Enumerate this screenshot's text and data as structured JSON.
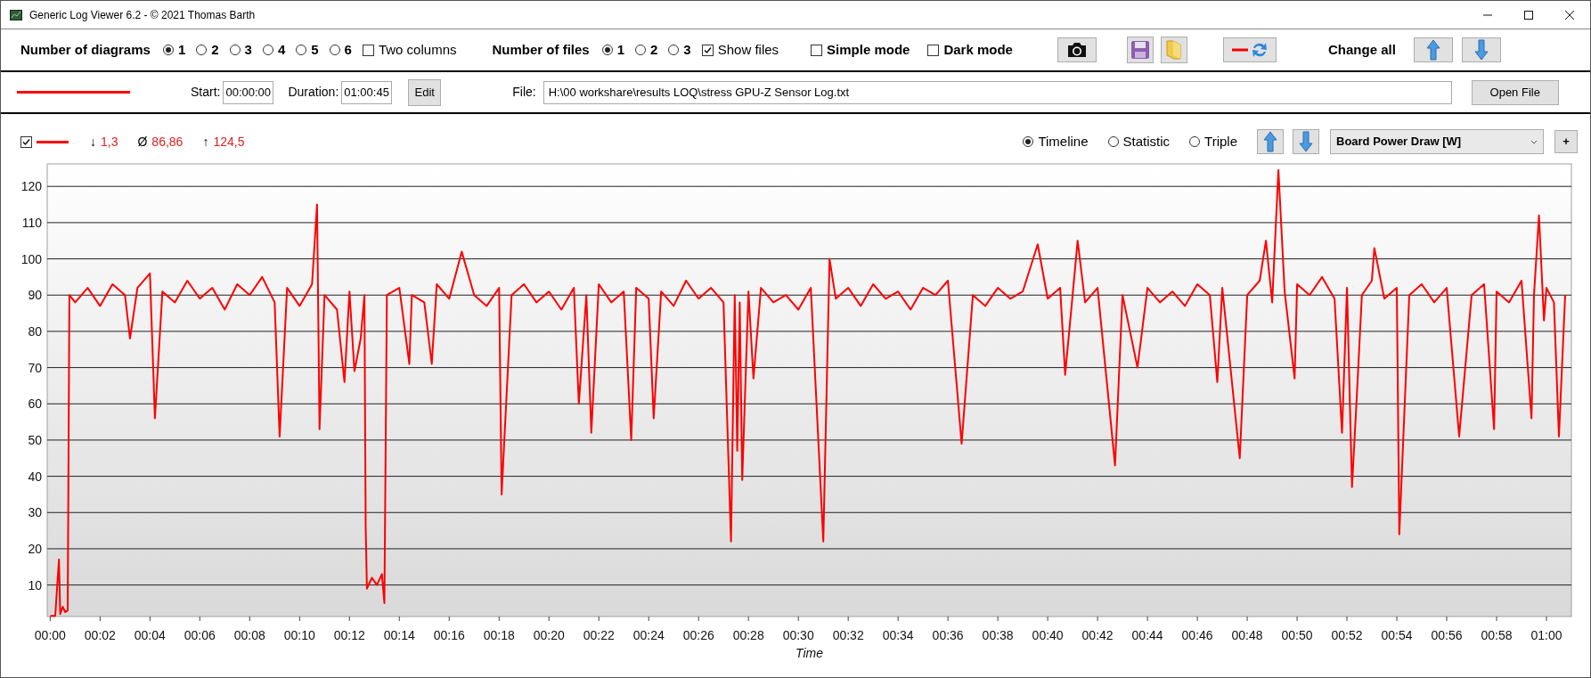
{
  "window": {
    "title": "Generic Log Viewer 6.2 - © 2021 Thomas Barth"
  },
  "toolbar": {
    "diagrams": {
      "label": "Number of diagrams",
      "options": [
        {
          "label": "1",
          "selected": true
        },
        {
          "label": "2",
          "selected": false
        },
        {
          "label": "3",
          "selected": false
        },
        {
          "label": "4",
          "selected": false
        },
        {
          "label": "5",
          "selected": false
        },
        {
          "label": "6",
          "selected": false
        }
      ]
    },
    "two_columns": {
      "label": "Two columns",
      "checked": false
    },
    "files": {
      "label": "Number of files",
      "options": [
        {
          "label": "1",
          "selected": true
        },
        {
          "label": "2",
          "selected": false
        },
        {
          "label": "3",
          "selected": false
        }
      ]
    },
    "show_files": {
      "label": "Show files",
      "checked": true
    },
    "simple_mode": {
      "label": "Simple mode",
      "checked": false
    },
    "dark_mode": {
      "label": "Dark mode",
      "checked": false
    },
    "change_all": "Change all"
  },
  "file_row": {
    "start_label": "Start:",
    "start": "00:00:00",
    "duration_label": "Duration:",
    "duration": "01:00:45",
    "edit_button": "Edit",
    "file_label": "File:",
    "file_path": "H:\\00 workshare\\results LOQ\\stress GPU-Z Sensor Log.txt",
    "open_button": "Open File"
  },
  "diagram": {
    "visible": true,
    "stats": [
      {
        "symbol": "↓",
        "value": "1,3"
      },
      {
        "symbol": "Ø",
        "value": "86,86"
      },
      {
        "symbol": "↑",
        "value": "124,5"
      }
    ],
    "views": [
      {
        "label": "Timeline",
        "selected": true
      },
      {
        "label": "Statistic",
        "selected": false
      },
      {
        "label": "Triple",
        "selected": false
      }
    ],
    "add_button": "+",
    "chart_data": {
      "type": "line",
      "xlabel": "Time",
      "grid": true,
      "xlim": [
        -0.12,
        61
      ],
      "ylim": [
        1.3,
        126.2
      ],
      "yticks": [
        10,
        20,
        30,
        40,
        50,
        60,
        70,
        80,
        90,
        100,
        110,
        120
      ],
      "xticks": [
        {
          "value": 0,
          "label": "00:00"
        },
        {
          "value": 2,
          "label": "00:02"
        },
        {
          "value": 4,
          "label": "00:04"
        },
        {
          "value": 6,
          "label": "00:06"
        },
        {
          "value": 8,
          "label": "00:08"
        },
        {
          "value": 10,
          "label": "00:10"
        },
        {
          "value": 12,
          "label": "00:12"
        },
        {
          "value": 14,
          "label": "00:14"
        },
        {
          "value": 16,
          "label": "00:16"
        },
        {
          "value": 18,
          "label": "00:18"
        },
        {
          "value": 20,
          "label": "00:20"
        },
        {
          "value": 22,
          "label": "00:22"
        },
        {
          "value": 24,
          "label": "00:24"
        },
        {
          "value": 26,
          "label": "00:26"
        },
        {
          "value": 28,
          "label": "00:28"
        },
        {
          "value": 30,
          "label": "00:30"
        },
        {
          "value": 32,
          "label": "00:32"
        },
        {
          "value": 34,
          "label": "00:34"
        },
        {
          "value": 36,
          "label": "00:36"
        },
        {
          "value": 38,
          "label": "00:38"
        },
        {
          "value": 40,
          "label": "00:40"
        },
        {
          "value": 42,
          "label": "00:42"
        },
        {
          "value": 44,
          "label": "00:44"
        },
        {
          "value": 46,
          "label": "00:46"
        },
        {
          "value": 48,
          "label": "00:48"
        },
        {
          "value": 50,
          "label": "00:50"
        },
        {
          "value": 52,
          "label": "00:52"
        },
        {
          "value": 54,
          "label": "00:54"
        },
        {
          "value": 56,
          "label": "00:56"
        },
        {
          "value": 58,
          "label": "00:58"
        },
        {
          "value": 60,
          "label": "01:00"
        }
      ],
      "x": [
        0,
        0.2,
        0.35,
        0.4,
        0.5,
        0.6,
        0.7,
        0.77,
        1,
        1.5,
        2,
        2.5,
        3,
        3.2,
        3.5,
        4,
        4.2,
        4.5,
        5,
        5.5,
        6,
        6.5,
        7,
        7.5,
        8,
        8.5,
        9,
        9.2,
        9.5,
        10,
        10.5,
        10.7,
        10.8,
        11,
        11.5,
        11.8,
        12,
        12.2,
        12.45,
        12.6,
        12.65,
        12.7,
        12.9,
        13.1,
        13.3,
        13.4,
        13.5,
        14,
        14.4,
        14.5,
        15,
        15.3,
        15.5,
        16,
        16.5,
        17,
        17.5,
        18,
        18.1,
        18.5,
        19,
        19.5,
        20,
        20.5,
        21,
        21.2,
        21.5,
        21.7,
        22,
        22.5,
        23,
        23.3,
        23.5,
        24,
        24.2,
        24.5,
        25,
        25.5,
        26,
        26.5,
        27,
        27.3,
        27.45,
        27.55,
        27.65,
        27.75,
        28,
        28.2,
        28.5,
        29,
        29.5,
        30,
        30.5,
        31,
        31.25,
        31.5,
        32,
        32.5,
        33,
        33.5,
        34,
        34.5,
        35,
        35.5,
        36,
        36.55,
        37,
        37.5,
        38,
        38.5,
        39,
        39.6,
        40,
        40.5,
        40.7,
        41,
        41.2,
        41.5,
        42,
        42.7,
        43,
        43.6,
        44,
        44.5,
        45,
        45.5,
        46,
        46.5,
        46.8,
        47,
        47.7,
        48,
        48.5,
        48.75,
        49,
        49.25,
        49.5,
        49.9,
        50,
        50.5,
        51,
        51.5,
        51.8,
        52,
        52.2,
        52.4,
        52.6,
        53,
        53.1,
        53.5,
        54,
        54.1,
        54.5,
        55,
        55.5,
        56,
        56.5,
        57,
        57.5,
        57.9,
        58,
        58.5,
        59,
        59.4,
        59.5,
        59.7,
        59.9,
        60,
        60.3,
        60.5,
        60.75
      ],
      "series": [
        {
          "name": "Board Power Draw [W]",
          "color": "#ff0000",
          "values": [
            1.5,
            1.5,
            17,
            2,
            4,
            2.5,
            3,
            90,
            88,
            92,
            87,
            93,
            90,
            78,
            92,
            96,
            56,
            91,
            88,
            94,
            89,
            92,
            86,
            93,
            90,
            95,
            88,
            51,
            92,
            87,
            93,
            115,
            53,
            90,
            86,
            66,
            91,
            69,
            78,
            90,
            26,
            9,
            12,
            10,
            13,
            5,
            90,
            92,
            71,
            90,
            88,
            71,
            93,
            89,
            102,
            90,
            87,
            92,
            35,
            90,
            93,
            88,
            91,
            86,
            92,
            60,
            90,
            52,
            93,
            88,
            91,
            50,
            92,
            89,
            56,
            91,
            87,
            94,
            89,
            92,
            88,
            22,
            90,
            47,
            88,
            39,
            91,
            67,
            92,
            88,
            90,
            86,
            92,
            22,
            100,
            89,
            92,
            87,
            93,
            89,
            91,
            86,
            92,
            90,
            94,
            49,
            90,
            87,
            92,
            89,
            91,
            104,
            89,
            92,
            68,
            90,
            105,
            88,
            92,
            43,
            90,
            70,
            92,
            88,
            91,
            87,
            93,
            90,
            66,
            92,
            45,
            90,
            94,
            105,
            88,
            124.5,
            91,
            67,
            93,
            90,
            95,
            89,
            52,
            92,
            37,
            63,
            90,
            94,
            103,
            89,
            92,
            24,
            90,
            93,
            88,
            92,
            51,
            90,
            93,
            53,
            91,
            88,
            94,
            56,
            90,
            112,
            83,
            92,
            88,
            51,
            90
          ]
        }
      ]
    }
  }
}
